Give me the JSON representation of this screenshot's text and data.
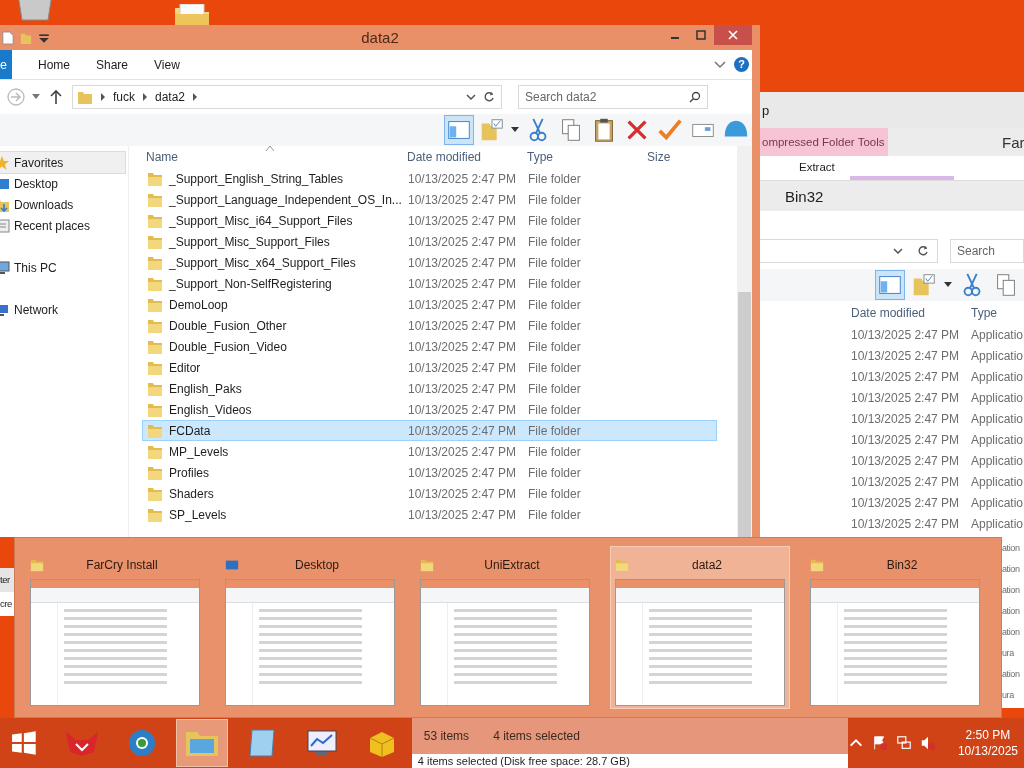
{
  "back_window": {
    "title": "p",
    "context_tab": "ompressed Folder Tools",
    "cut_tab": "Far",
    "ribbon_tab": "Extract",
    "location": "Bin32",
    "search": {
      "placeholder": "Search"
    },
    "columns": [
      "Date modified",
      "Type"
    ],
    "rows": [
      {
        "date": "10/13/2025 2:47 PM",
        "type": "Applicatio"
      },
      {
        "date": "10/13/2025 2:47 PM",
        "type": "Applicatio"
      },
      {
        "date": "10/13/2025 2:47 PM",
        "type": "Applicatio"
      },
      {
        "date": "10/13/2025 2:47 PM",
        "type": "Applicatio"
      },
      {
        "date": "10/13/2025 2:47 PM",
        "type": "Applicatio"
      },
      {
        "date": "10/13/2025 2:47 PM",
        "type": "Applicatio"
      },
      {
        "date": "10/13/2025 2:47 PM",
        "type": "Applicatio"
      },
      {
        "date": "10/13/2025 2:47 PM",
        "type": "Applicatio"
      },
      {
        "date": "10/13/2025 2:47 PM",
        "type": "Applicatio"
      },
      {
        "date": "10/13/2025 2:47 PM",
        "type": "Applicatio"
      }
    ],
    "edge_fragments": [
      "ation",
      "ation",
      "ation",
      "ation",
      "ation",
      "ura",
      "ation",
      "ura"
    ]
  },
  "left_fragments": [
    "ter",
    "cre"
  ],
  "window": {
    "title": "data2",
    "file_tab": "e",
    "tabs": [
      "Home",
      "Share",
      "View"
    ],
    "help": "?",
    "path": [
      "fuck",
      "data2"
    ],
    "search": {
      "placeholder": "Search data2"
    },
    "nav": [
      {
        "label": "Favorites",
        "kind": "favorites",
        "highlighted": true
      },
      {
        "label": "Desktop",
        "kind": "desktop",
        "highlighted": false
      },
      {
        "label": "Downloads",
        "kind": "downloads",
        "highlighted": false
      },
      {
        "label": "Recent places",
        "kind": "recent",
        "highlighted": false
      },
      {
        "label": "This PC",
        "kind": "pc",
        "highlighted": false
      },
      {
        "label": "Network",
        "kind": "network",
        "highlighted": false
      }
    ],
    "columns": [
      "Name",
      "Date modified",
      "Type",
      "Size"
    ],
    "rows": [
      {
        "name": "_Support_English_String_Tables",
        "date": "10/13/2025 2:47 PM",
        "type": "File folder",
        "selected": false
      },
      {
        "name": "_Support_Language_Independent_OS_In...",
        "date": "10/13/2025 2:47 PM",
        "type": "File folder",
        "selected": false
      },
      {
        "name": "_Support_Misc_i64_Support_Files",
        "date": "10/13/2025 2:47 PM",
        "type": "File folder",
        "selected": false
      },
      {
        "name": "_Support_Misc_Support_Files",
        "date": "10/13/2025 2:47 PM",
        "type": "File folder",
        "selected": false
      },
      {
        "name": "_Support_Misc_x64_Support_Files",
        "date": "10/13/2025 2:47 PM",
        "type": "File folder",
        "selected": false
      },
      {
        "name": "_Support_Non-SelfRegistering",
        "date": "10/13/2025 2:47 PM",
        "type": "File folder",
        "selected": false
      },
      {
        "name": "DemoLoop",
        "date": "10/13/2025 2:47 PM",
        "type": "File folder",
        "selected": false
      },
      {
        "name": "Double_Fusion_Other",
        "date": "10/13/2025 2:47 PM",
        "type": "File folder",
        "selected": false
      },
      {
        "name": "Double_Fusion_Video",
        "date": "10/13/2025 2:47 PM",
        "type": "File folder",
        "selected": false
      },
      {
        "name": "Editor",
        "date": "10/13/2025 2:47 PM",
        "type": "File folder",
        "selected": false
      },
      {
        "name": "English_Paks",
        "date": "10/13/2025 2:47 PM",
        "type": "File folder",
        "selected": false
      },
      {
        "name": "English_Videos",
        "date": "10/13/2025 2:47 PM",
        "type": "File folder",
        "selected": false
      },
      {
        "name": "FCData",
        "date": "10/13/2025 2:47 PM",
        "type": "File folder",
        "selected": true
      },
      {
        "name": "MP_Levels",
        "date": "10/13/2025 2:47 PM",
        "type": "File folder",
        "selected": false
      },
      {
        "name": "Profiles",
        "date": "10/13/2025 2:47 PM",
        "type": "File folder",
        "selected": false
      },
      {
        "name": "Shaders",
        "date": "10/13/2025 2:47 PM",
        "type": "File folder",
        "selected": false
      },
      {
        "name": "SP_Levels",
        "date": "10/13/2025 2:47 PM",
        "type": "File folder",
        "selected": false
      }
    ]
  },
  "switcher": [
    {
      "title": "FarCry Install",
      "kind": "folder",
      "selected": false
    },
    {
      "title": "Desktop",
      "kind": "desktop",
      "selected": false
    },
    {
      "title": "UniExtract",
      "kind": "folder",
      "selected": false
    },
    {
      "title": "data2",
      "kind": "folder",
      "selected": true
    },
    {
      "title": "Bin32",
      "kind": "folder",
      "selected": false
    }
  ],
  "peek_window": {
    "item_count": "53 items",
    "selection": "4 items selected",
    "details": "4 items selected (Disk free space: 28.7 GB)"
  },
  "taskbar": {
    "apps": [
      {
        "kind": "fox",
        "active": false
      },
      {
        "kind": "globe",
        "active": false
      },
      {
        "kind": "explorer",
        "active": true
      },
      {
        "kind": "notepad",
        "active": false
      },
      {
        "kind": "monitor",
        "active": false
      },
      {
        "kind": "box",
        "active": false
      }
    ],
    "time": "2:50 PM",
    "date": "10/13/2025"
  }
}
